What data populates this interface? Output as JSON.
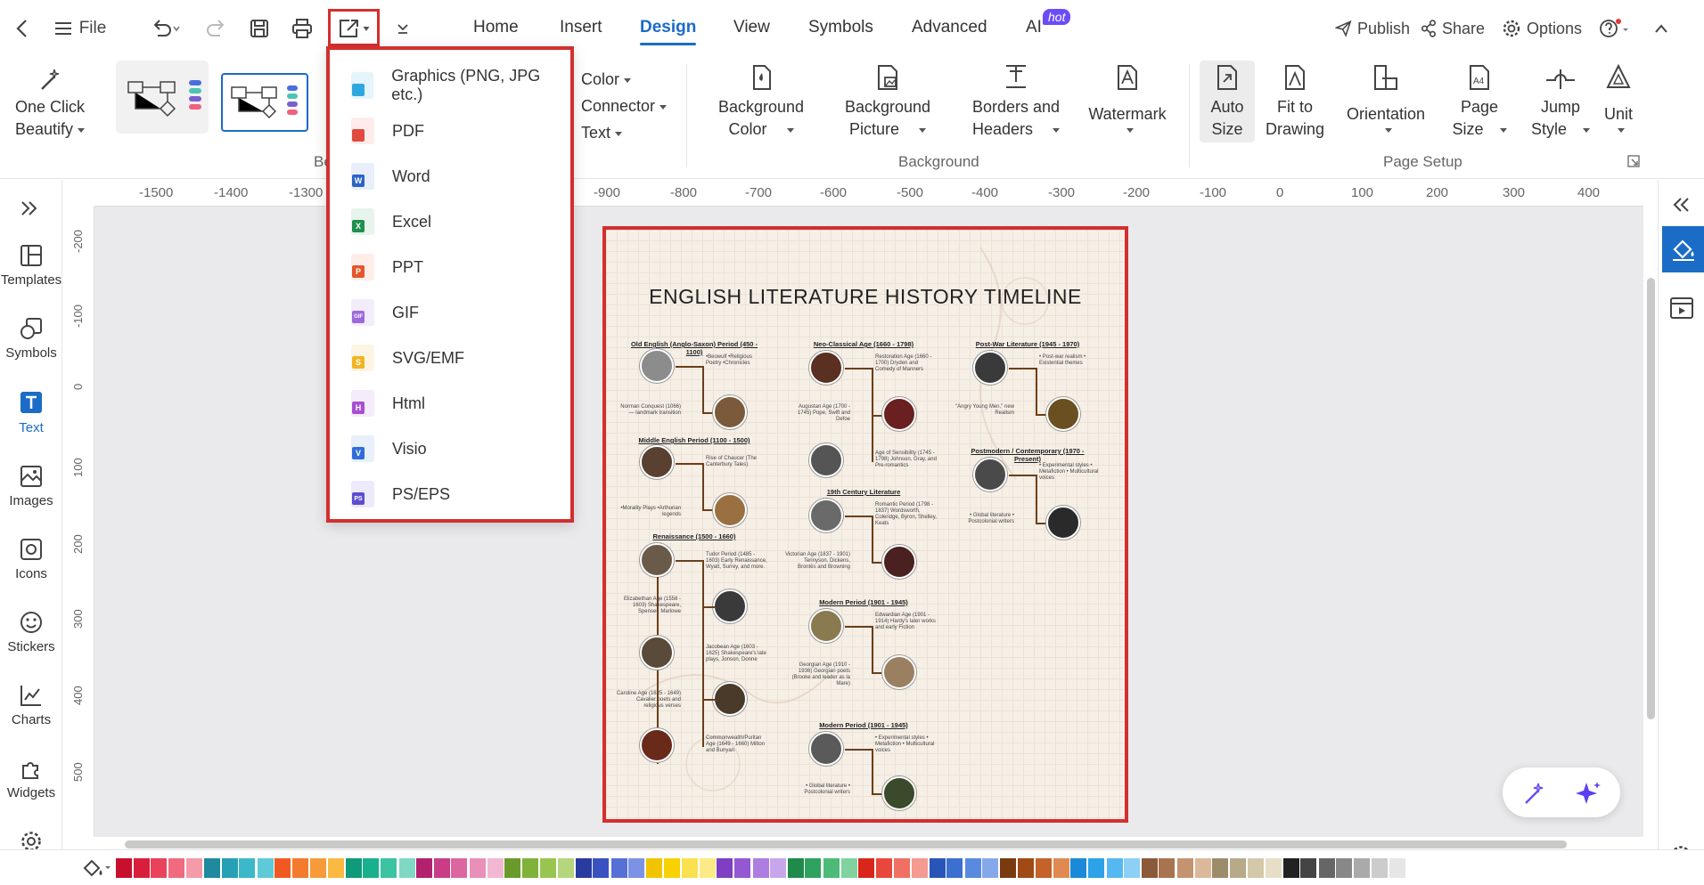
{
  "topbar": {
    "file_label": "File",
    "tabs": [
      {
        "label": "Home",
        "active": false
      },
      {
        "label": "Insert",
        "active": false
      },
      {
        "label": "Design",
        "active": true
      },
      {
        "label": "View",
        "active": false
      },
      {
        "label": "Symbols",
        "active": false
      },
      {
        "label": "Advanced",
        "active": false
      },
      {
        "label": "AI",
        "active": false
      }
    ],
    "ai_badge": "hot",
    "publish": "Publish",
    "share": "Share",
    "options": "Options"
  },
  "ribbon": {
    "one_click_beautify": [
      "One Click",
      "Beautify"
    ],
    "group_beautify_fragment": "Be",
    "style_options": [
      "Color",
      "Connector",
      "Text"
    ],
    "background_color": [
      "Background",
      "Color"
    ],
    "background_picture": [
      "Background",
      "Picture"
    ],
    "borders_headers": [
      "Borders and",
      "Headers"
    ],
    "watermark": "Watermark",
    "group_background": "Background",
    "auto_size": [
      "Auto",
      "Size"
    ],
    "fit_to_drawing": [
      "Fit to",
      "Drawing"
    ],
    "orientation": "Orientation",
    "page_size": [
      "Page",
      "Size"
    ],
    "jump_style": [
      "Jump",
      "Style"
    ],
    "unit": "Unit",
    "group_page_setup": "Page Setup"
  },
  "export_menu": {
    "items": [
      {
        "label": "Graphics (PNG, JPG etc.)",
        "color": "#2fa8e0",
        "tag": ""
      },
      {
        "label": "PDF",
        "color": "#e04a3f",
        "tag": ""
      },
      {
        "label": "Word",
        "color": "#2b63c8",
        "tag": "W"
      },
      {
        "label": "Excel",
        "color": "#1f8f4e",
        "tag": "X"
      },
      {
        "label": "PPT",
        "color": "#e4572e",
        "tag": "P"
      },
      {
        "label": "GIF",
        "color": "#9b6bdc",
        "tag": "GIF"
      },
      {
        "label": "SVG/EMF",
        "color": "#f1b523",
        "tag": "S"
      },
      {
        "label": "Html",
        "color": "#a64fd0",
        "tag": "H"
      },
      {
        "label": "Visio",
        "color": "#2f6ed8",
        "tag": "V"
      },
      {
        "label": "PS/EPS",
        "color": "#5a4fcf",
        "tag": "PS"
      }
    ]
  },
  "leftbar": {
    "items": [
      {
        "label": "Templates",
        "icon": "templates-icon"
      },
      {
        "label": "Symbols",
        "icon": "symbols-icon"
      },
      {
        "label": "Text",
        "icon": "text-icon",
        "active": true
      },
      {
        "label": "Images",
        "icon": "images-icon"
      },
      {
        "label": "Icons",
        "icon": "icons-icon"
      },
      {
        "label": "Stickers",
        "icon": "stickers-icon"
      },
      {
        "label": "Charts",
        "icon": "charts-icon"
      },
      {
        "label": "Widgets",
        "icon": "widgets-icon"
      }
    ]
  },
  "ruler": {
    "h_labels": [
      "-1500",
      "-1400",
      "-1300",
      "-900",
      "-800",
      "-700",
      "-600",
      "-500",
      "-400",
      "-300",
      "-200",
      "-100",
      "0",
      "100",
      "200",
      "300",
      "400"
    ],
    "v_labels": [
      "-200",
      "-100",
      "0",
      "100",
      "200",
      "300",
      "400",
      "500"
    ]
  },
  "diagram": {
    "title": "ENGLISH LITERATURE HISTORY TIMELINE",
    "sections": [
      "Old English (Anglo-Saxon) Period (450 - 1100)",
      "Middle English Period (1100 - 1500)",
      "Renaissance (1500 - 1660)",
      "Neo-Classical Age (1660 - 1798)",
      "19th Century Literature",
      "Modern Period (1901 - 1945)",
      "Modern Period (1901 - 1945)",
      "Post-War Literature (1945 - 1970)",
      "Postmodern / Contemporary (1970 - Present)"
    ],
    "notes": [
      "•Beowulf •Religious Poetry •Chronicles",
      "Norman Conquest (1066) — landmark transition",
      "Rise of Chaucer (The Canterbury Tales)",
      "•Morality Plays •Arthurian legends",
      "Tudor Period (1485 - 1603) Early Renaissance, Wyatt, Surrey, and more.",
      "Elizabethan Age (1558 - 1603) Shakespeare, Spenser, Marlowe",
      "Jacobean Age (1603 - 1625) Shakespeare's late plays, Jonson, Donne",
      "Caroline Age (1625 - 1649) Cavalier poets and religious verses",
      "Commonwealth/Puritan Age (1649 - 1660) Milton and Bunyan",
      "Restoration Age (1660 - 1700) Dryden and Comedy of Manners",
      "Augustan Age (1700 - 1745) Pope, Swift and Defoe",
      "Age of Sensibility (1745 - 1798) Johnson, Gray, and Pre-romantics",
      "Romantic Period (1798 - 1837) Wordsworth, Coleridge, Byron, Shelley, Keats",
      "Victorian Age (1837 - 1901) Tennyson, Dickens, Brontës and Browning",
      "Edwardian Age (1901 - 1914) Hardy's later works and early Fiction",
      "Georgian Age (1910 - 1936) Georgian poets (Brooke and leader as la Mare)",
      "• Experimental styles • Metafiction • Multicultural voices",
      "• Global literature • Postcolonial writers",
      "• Post-war realism • Existential themes",
      "\"Angry Young Men,\" new Realism",
      "• Experimental styles • Metafiction • Multicultural voices",
      "• Global literature • Postcolonial writers"
    ]
  },
  "palette": {
    "colors": [
      "#c8102e",
      "#d81e3c",
      "#e8435a",
      "#f06b7e",
      "#f49aa8",
      "#1f8a9e",
      "#26a0b5",
      "#3bb8c9",
      "#5fcad7",
      "#f05a22",
      "#f47b2e",
      "#f79a3a",
      "#fbb942",
      "#0f9a7a",
      "#19b08e",
      "#3cc3a2",
      "#7fd8c4",
      "#b3206e",
      "#c93d86",
      "#dc66a0",
      "#e890b8",
      "#f2b8d2",
      "#6a9b2a",
      "#80b23a",
      "#98c550",
      "#b4d67c",
      "#2a3ba0",
      "#3a52c0",
      "#5670d6",
      "#7c92e4",
      "#f2c400",
      "#f7d200",
      "#fbe050",
      "#fcea86",
      "#7e3fc2",
      "#9458d4",
      "#ad7ee0",
      "#c8a6ec",
      "#1f8a4a",
      "#2ea25e",
      "#4cbb78",
      "#80d29e",
      "#d9261c",
      "#e8483c",
      "#f07064",
      "#f59a90",
      "#2a55b8",
      "#3b6fd0",
      "#5a8ae0",
      "#86a8ea",
      "#7a3a10",
      "#a04a16",
      "#c4622a",
      "#e08a52",
      "#1a8ad8",
      "#2ea2e8",
      "#56b8f0",
      "#8cd0f6",
      "#8a5a3a",
      "#a87450",
      "#c49472",
      "#dcb89a",
      "#9c8c6a",
      "#b8aa88",
      "#d4c8aa",
      "#e8dec8",
      "#222222",
      "#444444",
      "#666666",
      "#888888",
      "#aaaaaa",
      "#cccccc",
      "#e6e6e6"
    ]
  }
}
